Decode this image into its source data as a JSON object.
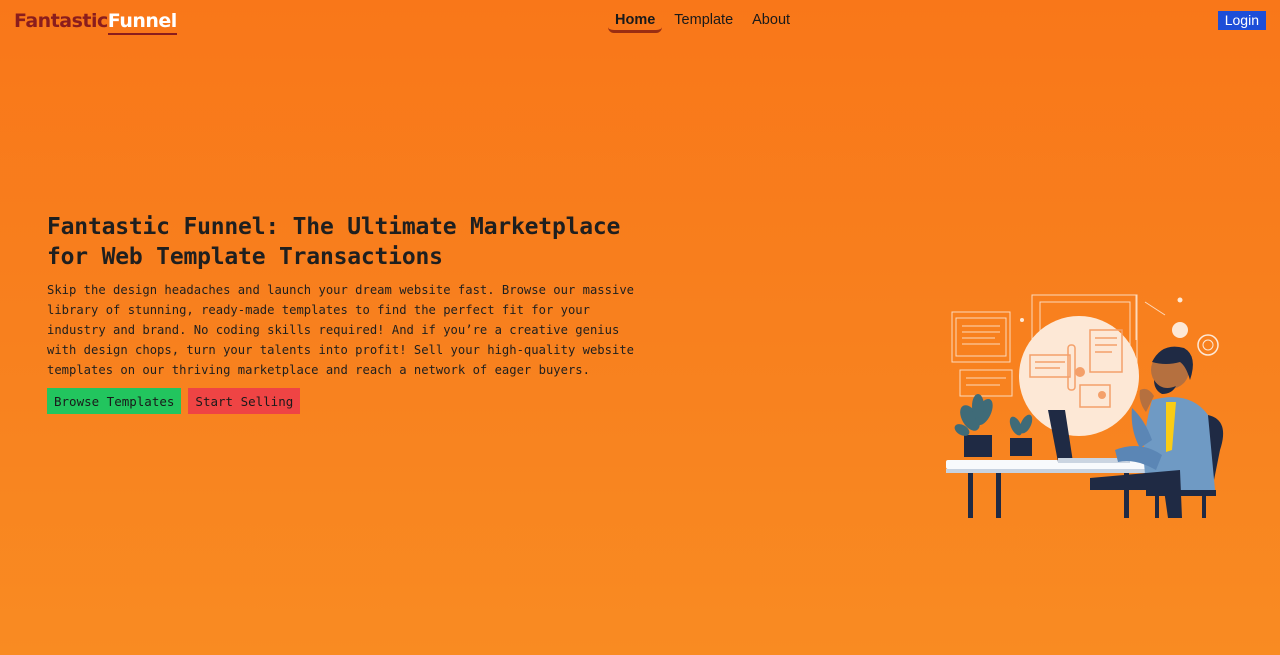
{
  "header": {
    "logo_part1": "Fantastic",
    "logo_part2": "Funnel",
    "nav": [
      {
        "label": "Home",
        "active": true
      },
      {
        "label": "Template",
        "active": false
      },
      {
        "label": "About",
        "active": false
      }
    ],
    "login_label": "Login"
  },
  "hero": {
    "title": "Fantastic Funnel: The Ultimate Marketplace for Web Template Transactions",
    "description": "Skip the design headaches and launch your dream website fast. Browse our massive library of stunning, ready-made templates to find the perfect fit for your industry and brand. No coding skills required! And if you’re a creative genius with design chops, turn your talents into profit! Sell your high-quality website templates on our thriving marketplace and reach a network of eager buyers.",
    "browse_label": "Browse Templates",
    "sell_label": "Start Selling"
  },
  "colors": {
    "background": "#f97719",
    "logo_dark": "#8a1d1d",
    "login": "#1d4ed8",
    "browse": "#22c55e",
    "sell": "#ef4444"
  },
  "illustration": {
    "icon": "man-working-on-laptop-illustration"
  }
}
